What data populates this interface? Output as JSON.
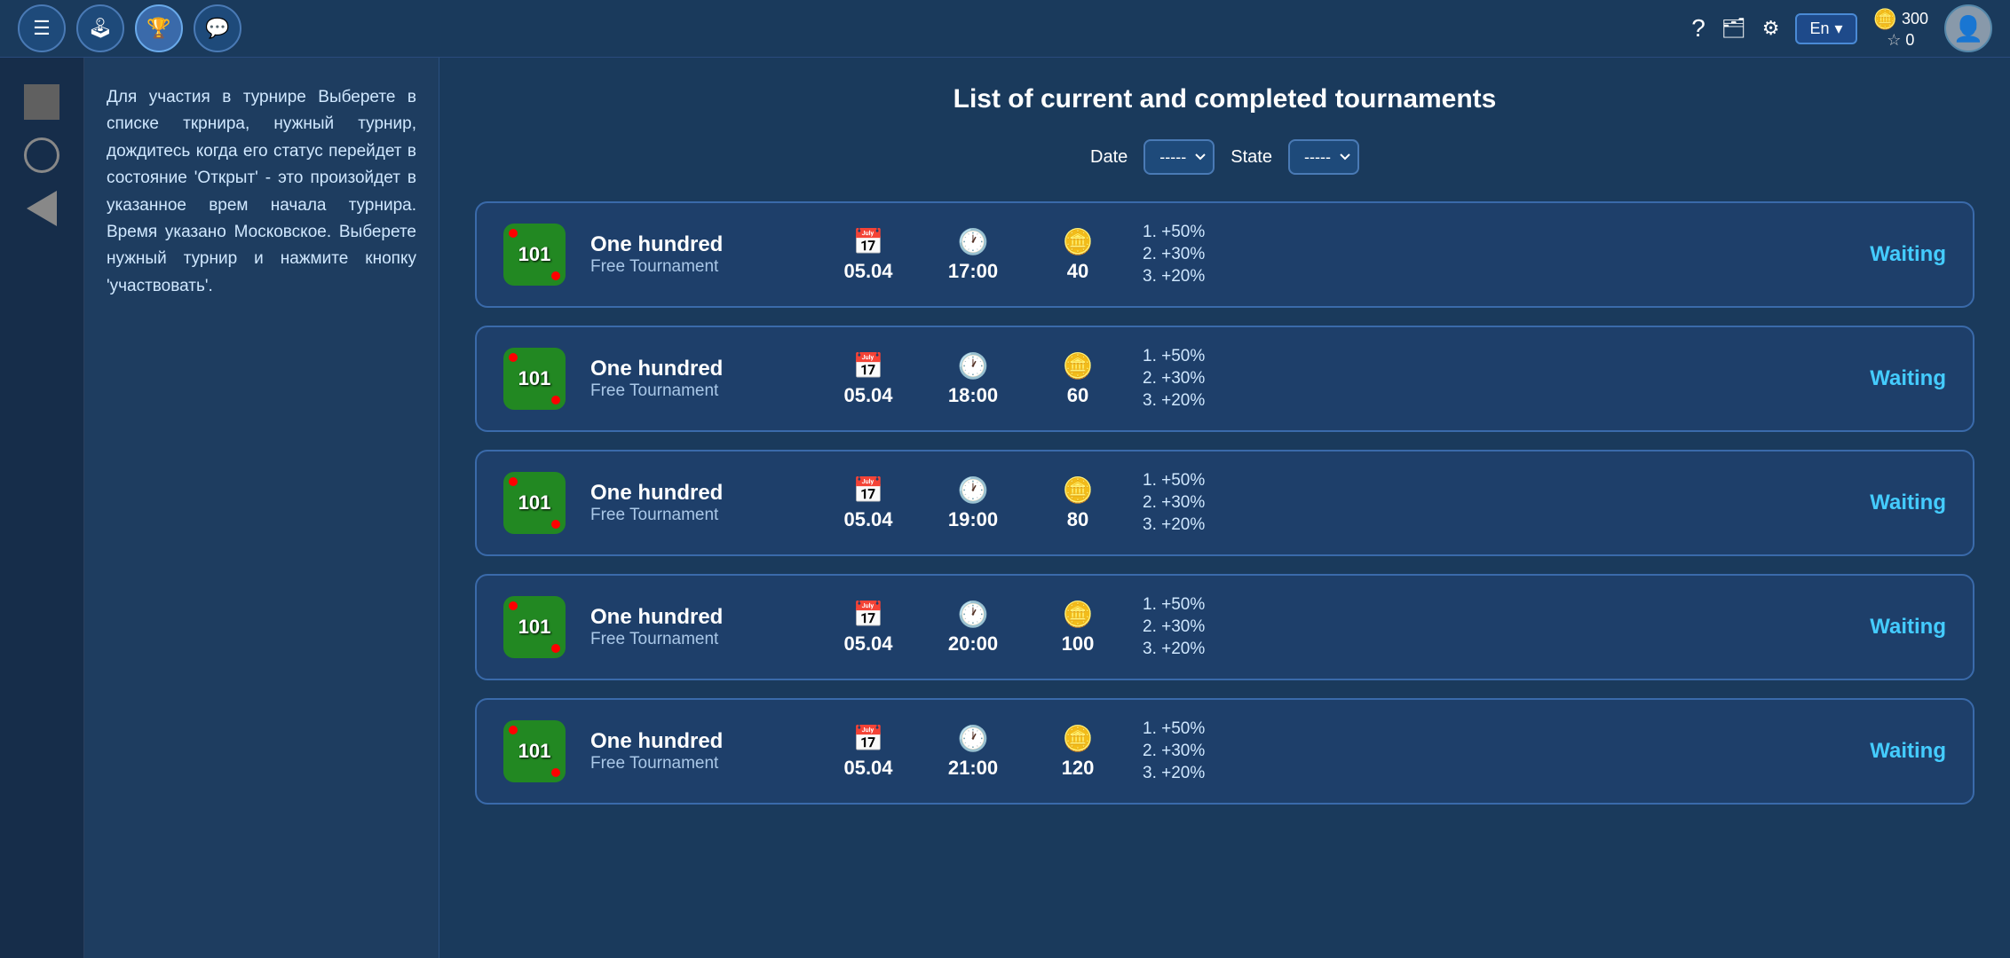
{
  "navbar": {
    "menu_icon": "☰",
    "gamepad_icon": "🎮",
    "trophy_icon": "🏆",
    "chat_icon": "💬",
    "question_icon": "?",
    "wallet_icon": "👜",
    "gear_icon": "⚙",
    "lang_label": "En",
    "lang_arrow": "▾",
    "coins_amount": "300",
    "stars_amount": "0",
    "avatar_icon": "👤"
  },
  "filters": {
    "date_label": "Date",
    "date_default": "-----",
    "state_label": "State",
    "state_default": "-----"
  },
  "page": {
    "title": "List of current and completed tournaments"
  },
  "help_text": "Для участия в турнире Выберете в списке ткрнира, нужный турнир, дождитесь когда его статус перейдет в состояние 'Открыт' - это произойдет в указанное врем начала турнира. Время указано Московское. Выберете нужный турнир и нажмите кнопку 'участвовать'.",
  "tournaments": [
    {
      "id": 1,
      "icon_text": "101",
      "name": "One hundred",
      "type": "Free Tournament",
      "date": "05.04",
      "time": "17:00",
      "coins": "40",
      "prize1": "1. +50%",
      "prize2": "2. +30%",
      "prize3": "3. +20%",
      "status": "Waiting"
    },
    {
      "id": 2,
      "icon_text": "101",
      "name": "One hundred",
      "type": "Free Tournament",
      "date": "05.04",
      "time": "18:00",
      "coins": "60",
      "prize1": "1. +50%",
      "prize2": "2. +30%",
      "prize3": "3. +20%",
      "status": "Waiting"
    },
    {
      "id": 3,
      "icon_text": "101",
      "name": "One hundred",
      "type": "Free Tournament",
      "date": "05.04",
      "time": "19:00",
      "coins": "80",
      "prize1": "1. +50%",
      "prize2": "2. +30%",
      "prize3": "3. +20%",
      "status": "Waiting"
    },
    {
      "id": 4,
      "icon_text": "101",
      "name": "One hundred",
      "type": "Free Tournament",
      "date": "05.04",
      "time": "20:00",
      "coins": "100",
      "prize1": "1. +50%",
      "prize2": "2. +30%",
      "prize3": "3. +20%",
      "status": "Waiting"
    },
    {
      "id": 5,
      "icon_text": "101",
      "name": "One hundred",
      "type": "Free Tournament",
      "date": "05.04",
      "time": "21:00",
      "coins": "120",
      "prize1": "1. +50%",
      "prize2": "2. +30%",
      "prize3": "3. +20%",
      "status": "Waiting"
    }
  ]
}
